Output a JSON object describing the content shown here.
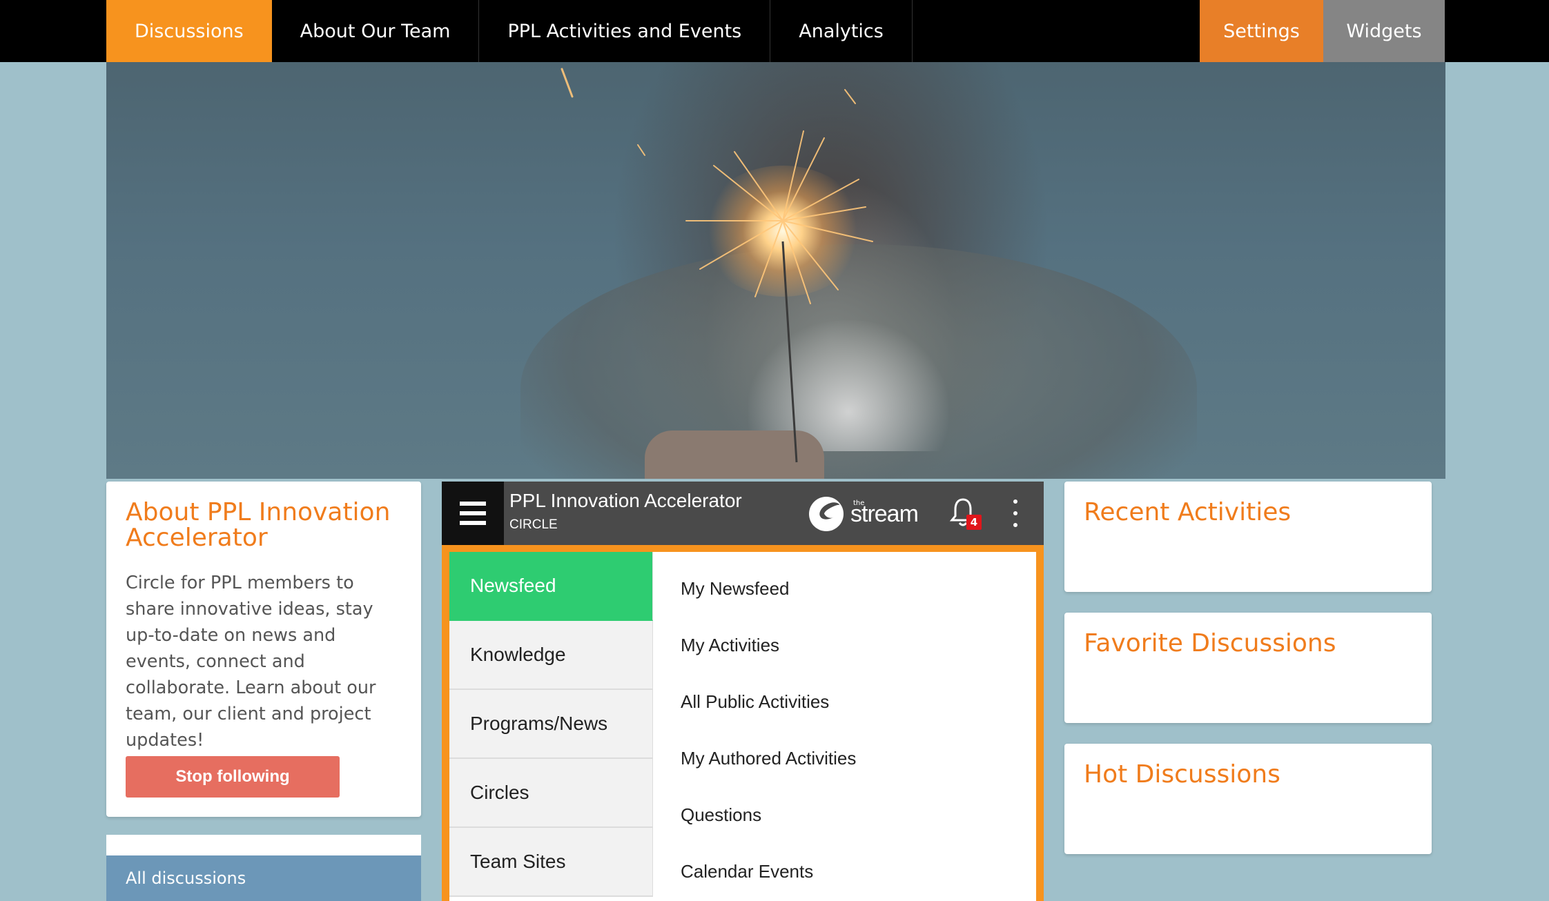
{
  "nav": {
    "items": [
      {
        "label": "Discussions",
        "active": true
      },
      {
        "label": "About Our Team",
        "active": false
      },
      {
        "label": "PPL Activities and Events",
        "active": false
      },
      {
        "label": "Analytics",
        "active": false
      }
    ],
    "settings_label": "Settings",
    "widgets_label": "Widgets"
  },
  "hero": {
    "image": "sparkler-held-by-person"
  },
  "about": {
    "title": "About PPL Innovation Accelerator",
    "description": "Circle for PPL members to share innovative ideas, stay up-to-date on news and events, connect and collaborate. Learn about our team, our client and project updates!",
    "button_label": "Stop following"
  },
  "discussions": {
    "all_label": "All discussions"
  },
  "stream": {
    "circle_name": "PPL Innovation Accelerator",
    "circle_type": "CIRCLE",
    "logo_small": "the",
    "logo_word": "stream",
    "notification_count": "4",
    "menu": [
      {
        "label": "Newsfeed",
        "active": true
      },
      {
        "label": "Knowledge",
        "active": false
      },
      {
        "label": "Programs/News",
        "active": false
      },
      {
        "label": "Circles",
        "active": false
      },
      {
        "label": "Team Sites",
        "active": false
      }
    ],
    "submenu": [
      "My Newsfeed",
      "My Activities",
      "All Public Activities",
      "My Authored Activities",
      "Questions",
      "Calendar Events"
    ]
  },
  "right_cards": {
    "recent": "Recent Activities",
    "favorite": "Favorite Discussions",
    "hot": "Hot Discussions"
  },
  "colors": {
    "accent_orange": "#f7931e",
    "title_orange": "#f07c1c",
    "newsfeed_green": "#2ecc71",
    "stop_button": "#e66e60",
    "background": "#9fc0ca"
  }
}
